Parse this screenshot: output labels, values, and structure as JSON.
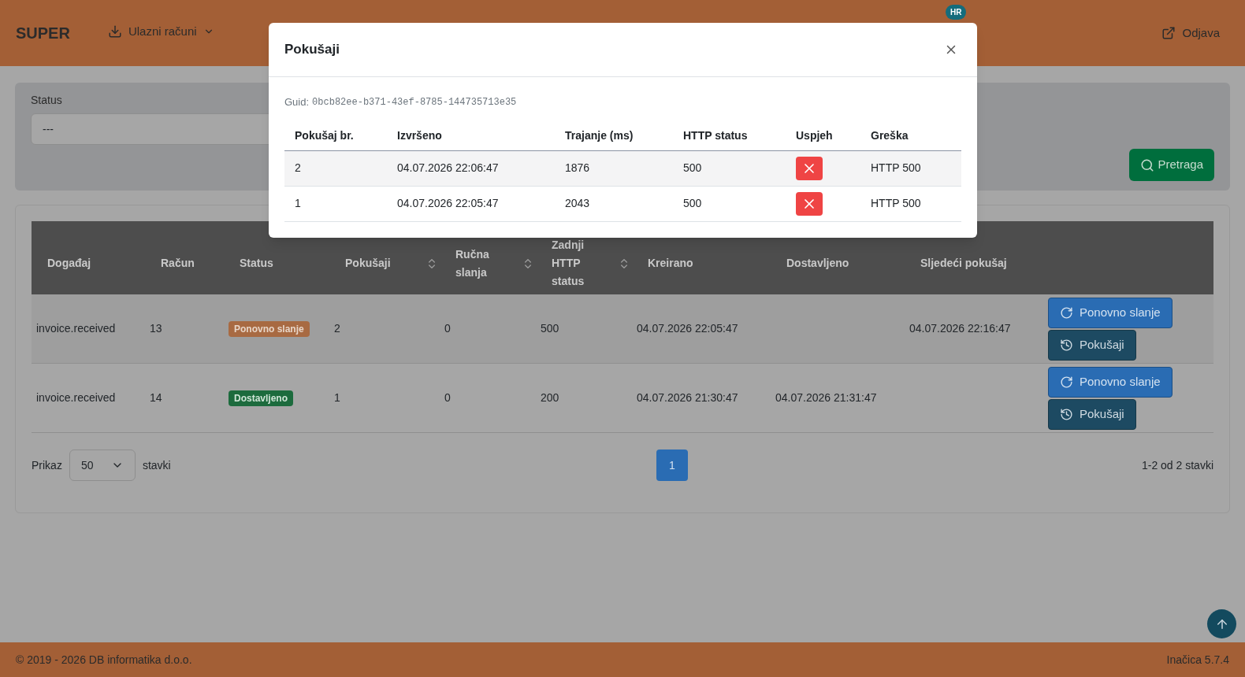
{
  "header": {
    "brand": "SUPER",
    "nav": [
      {
        "label": "Ulazni računi",
        "kind": "dropdown"
      }
    ],
    "language_badge": "HR",
    "logout": "Odjava"
  },
  "filter": {
    "label": "Status",
    "value": "---",
    "search_button": "Pretraga"
  },
  "table": {
    "columns": [
      {
        "label": "Događaj",
        "sortable": false
      },
      {
        "label": "Račun",
        "sortable": false
      },
      {
        "label": "Status",
        "sortable": false
      },
      {
        "label": "Pokušaji",
        "sortable": true
      },
      {
        "label": "Ručna slanja",
        "sortable": true
      },
      {
        "label": "Zadnji HTTP status",
        "sortable": true
      },
      {
        "label": "Kreirano",
        "sortable": false
      },
      {
        "label": "Dostavljeno",
        "sortable": false
      },
      {
        "label": "Sljedeći pokušaj",
        "sortable": false
      }
    ],
    "rows": [
      {
        "event": "invoice.received",
        "invoice": "13",
        "status": {
          "label": "Ponovno slanje",
          "kind": "retry"
        },
        "attempts": "2",
        "manual": "0",
        "http": "500",
        "created": "04.07.2026 22:05:47",
        "delivered": "",
        "next": "04.07.2026 22:16:47",
        "resend": "Ponovno slanje",
        "attempts_button": "Pokušaji"
      },
      {
        "event": "invoice.received",
        "invoice": "14",
        "status": {
          "label": "Dostavljeno",
          "kind": "delivered"
        },
        "attempts": "1",
        "manual": "0",
        "http": "200",
        "created": "04.07.2026 21:30:47",
        "delivered": "04.07.2026 21:31:47",
        "next": "",
        "resend": "Ponovno slanje",
        "attempts_button": "Pokušaji"
      }
    ]
  },
  "pagination": {
    "show_label": "Prikaz",
    "page_size": "50",
    "items_label": "stavki",
    "pages": [
      {
        "label": "1",
        "selected": true
      }
    ],
    "summary": "1-2 od 2 stavki"
  },
  "modal": {
    "title": "Pokušaji",
    "guid_label": "Guid:",
    "guid": "0bcb82ee-b371-43ef-8785-144735713e35",
    "columns": [
      "Pokušaj br.",
      "Izvršeno",
      "Trajanje (ms)",
      "HTTP status",
      "Uspjeh",
      "Greška"
    ],
    "rows": [
      {
        "number": "2",
        "executed": "04.07.2026 22:06:47",
        "duration": "1876",
        "http": "500",
        "success": false,
        "error": "HTTP 500"
      },
      {
        "number": "1",
        "executed": "04.07.2026 22:05:47",
        "duration": "2043",
        "http": "500",
        "success": false,
        "error": "HTTP 500"
      }
    ]
  },
  "footer": {
    "copyright": "© 2019 - 2026 DB informatika d.o.o.",
    "version": "Inačica 5.7.4"
  }
}
